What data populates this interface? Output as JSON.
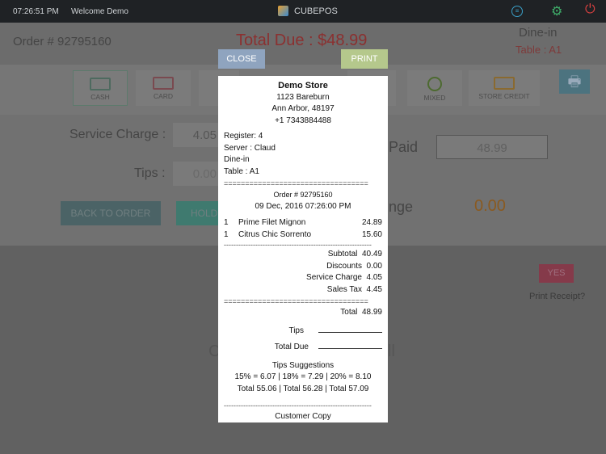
{
  "topbar": {
    "time": "07:26:51 PM",
    "welcome": "Welcome Demo",
    "brand": "CUBEPOS",
    "icons": [
      "list-icon",
      "gear-icon",
      "power-icon"
    ]
  },
  "header": {
    "order": "Order # 92795160",
    "total_due": "Total Due : $48.99",
    "dine": "Dine-in",
    "table": "Table : A1"
  },
  "tiles": [
    {
      "label": "CASH",
      "icon": "cash-icon"
    },
    {
      "label": "CARD",
      "icon": "card-icon"
    },
    {
      "label": "MIXED",
      "icon": "mixed-icon"
    },
    {
      "label": "STORE CREDIT",
      "icon": "store-credit-icon"
    }
  ],
  "panel": {
    "service_label": "Service Charge :",
    "service_value": "4.05",
    "tips_label": "Tips :",
    "tips_value": "0.00",
    "paid_label": "Paid",
    "paid_value": "48.99",
    "change_label": "nge",
    "change_value": "0.00",
    "back_label": "BACK TO ORDER",
    "hold_label": "HOLD"
  },
  "lower": {
    "yes": "YES",
    "print_receipt": "Print Receipt?",
    "partial_left": "C",
    "partial_right": "ll"
  },
  "modal": {
    "close": "CLOSE",
    "print": "PRINT"
  },
  "receipt": {
    "store": "Demo Store",
    "addr1": "1123 Bareburn",
    "addr2": "Ann Arbor, 48197",
    "phone": "+1 7343884488",
    "register": "Register: 4",
    "server": "Server : Claud",
    "type": "Dine-in",
    "table": "Table : A1",
    "sep_eq": "==================================",
    "order": "Order # 92795160",
    "date": "09 Dec, 2016 07:26:00 PM",
    "items": [
      {
        "qty": "1",
        "name": "Prime Filet Mignon",
        "price": "24.89"
      },
      {
        "qty": "1",
        "name": "Citrus Chic Sorrento",
        "price": "15.60"
      }
    ],
    "sep_dash": "-------------------------------------------------------------",
    "totals": [
      {
        "label": "Subtotal",
        "value": "40.49"
      },
      {
        "label": "Discounts",
        "value": "0.00"
      },
      {
        "label": "Service Charge",
        "value": "4.05"
      },
      {
        "label": "Sales Tax",
        "value": "4.45"
      }
    ],
    "total_label": "Total",
    "total_value": "48.99",
    "tips": "Tips",
    "total_due": "Total Due",
    "tips_title": "Tips  Suggestions",
    "tips_line1": "15% = 6.07  |  18% = 7.29  |  20% = 8.10",
    "tips_line2": "Total  55.06  |  Total  56.28  |  Total  57.09",
    "copy": "Customer Copy"
  },
  "colors": {
    "total_due": "#8b3030",
    "change": "#8a5a20",
    "close_btn": "#8fa4bf",
    "print_btn": "#b5c88c"
  }
}
